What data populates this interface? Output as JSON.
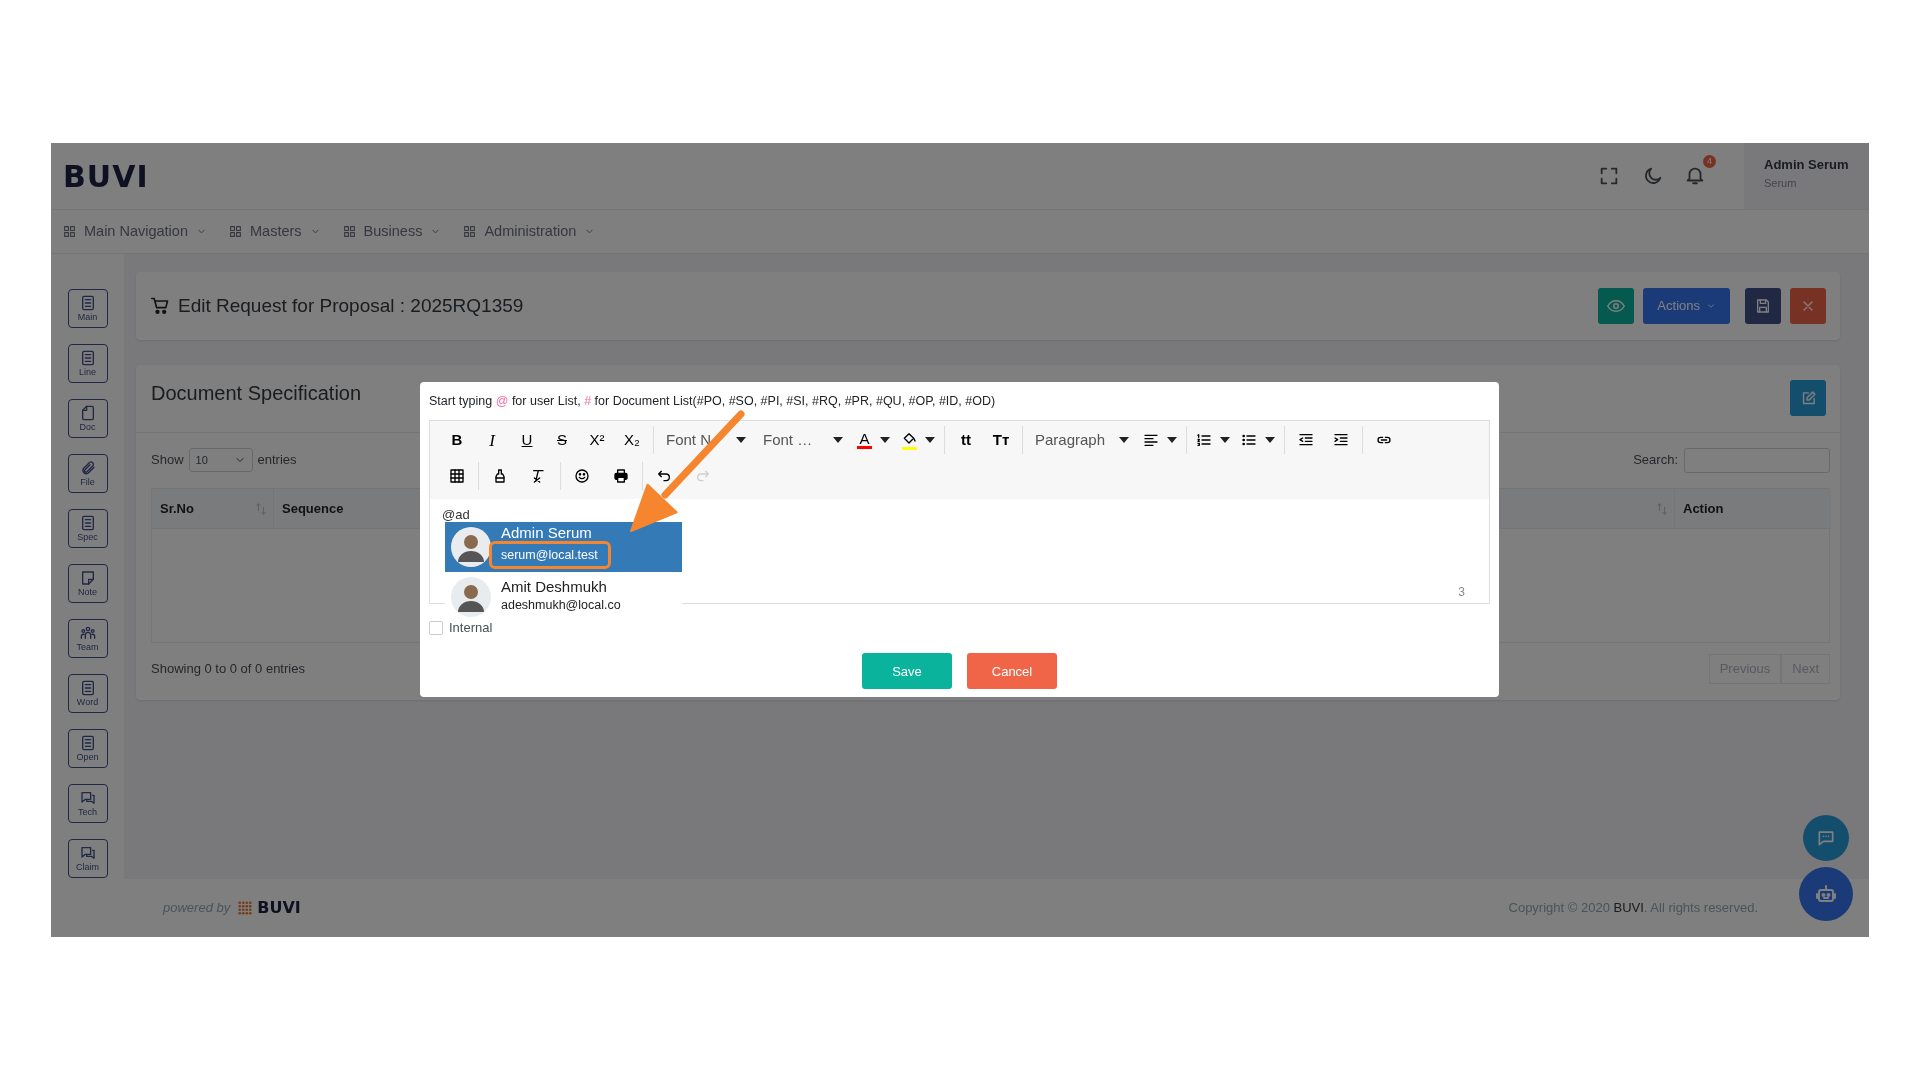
{
  "header": {
    "logo": "BUVI",
    "notification_count": "4",
    "user_name": "Admin Serum",
    "user_role": "Serum"
  },
  "nav": [
    {
      "label": "Main Navigation"
    },
    {
      "label": "Masters"
    },
    {
      "label": "Business"
    },
    {
      "label": "Administration"
    }
  ],
  "sidebar": [
    {
      "label": "Main",
      "kind": "list"
    },
    {
      "label": "Line",
      "kind": "list"
    },
    {
      "label": "Doc",
      "kind": "page"
    },
    {
      "label": "File",
      "kind": "clip"
    },
    {
      "label": "Spec",
      "kind": "list"
    },
    {
      "label": "Note",
      "kind": "note"
    },
    {
      "label": "Team",
      "kind": "team"
    },
    {
      "label": "Word",
      "kind": "list"
    },
    {
      "label": "Open",
      "kind": "list"
    },
    {
      "label": "Tech",
      "kind": "chat"
    },
    {
      "label": "Claim",
      "kind": "chat"
    }
  ],
  "page_header": {
    "title": "Edit Request for Proposal : 2025RQ1359",
    "actions_label": "Actions"
  },
  "spec_card": {
    "title": "Document Specification",
    "show_label": "Show",
    "page_size": "10",
    "entries_label": "entries",
    "search_label": "Search:",
    "columns": [
      {
        "label": "Sr.No",
        "sortable": true
      },
      {
        "label": "Sequence",
        "sortable": false
      },
      {
        "sortable": true
      },
      {
        "label": "Action",
        "sortable": false
      }
    ],
    "summary": "Showing 0 to 0 of 0 entries",
    "pager": [
      {
        "label": "Previous",
        "disabled": true
      },
      {
        "label": "Next",
        "disabled": true
      }
    ]
  },
  "modal": {
    "hint": [
      {
        "text": "Start typing ",
        "accent": false
      },
      {
        "text": "@",
        "accent": true
      },
      {
        "text": " for user List, ",
        "accent": false
      },
      {
        "text": "#",
        "accent": true
      },
      {
        "text": " for Document List(#PO, #SO, #PI, #SI, #RQ, #PR, #QU, #OP, #ID, #OD)",
        "accent": false
      }
    ],
    "toolbar": [
      [
        [
          {
            "kind": "bold",
            "text": "B"
          },
          {
            "kind": "italic",
            "text": "I"
          },
          {
            "kind": "underline",
            "text": "U"
          },
          {
            "kind": "strike",
            "text": "S"
          },
          {
            "kind": "sup",
            "text": "X²"
          },
          {
            "kind": "sub",
            "text": "X₂"
          }
        ],
        [
          {
            "kind": "select",
            "text": "Font N",
            "dropdown": true
          },
          {
            "kind": "select",
            "text": "Font …",
            "dropdown": true
          },
          {
            "kind": "forecolor",
            "text": "A",
            "color": "#ff0000",
            "dropdown": true
          },
          {
            "kind": "backcolor",
            "color": "#ffff00",
            "dropdown": true
          }
        ],
        [
          {
            "kind": "glyph",
            "text": "tt"
          },
          {
            "kind": "glyph",
            "text": "Tᴛ"
          }
        ],
        [
          {
            "kind": "select",
            "text": "Paragraph",
            "dropdown": true
          },
          {
            "kind": "align",
            "dropdown": true
          }
        ],
        [
          {
            "kind": "ol",
            "dropdown": true
          },
          {
            "kind": "ul",
            "dropdown": true
          }
        ],
        [
          {
            "kind": "outdent"
          },
          {
            "kind": "indent"
          }
        ],
        [
          {
            "kind": "link"
          }
        ]
      ],
      [
        [
          {
            "kind": "table"
          }
        ],
        [
          {
            "kind": "paint"
          },
          {
            "kind": "clear"
          }
        ],
        [
          {
            "kind": "emoji"
          },
          {
            "kind": "print"
          }
        ],
        [
          {
            "kind": "undo",
            "disabled": false
          },
          {
            "kind": "redo",
            "disabled": true
          }
        ]
      ]
    ],
    "content": "@ad",
    "word_count": "3",
    "mentions": [
      {
        "name": "Admin Serum",
        "email": "serum@local.test",
        "selected": true,
        "highlighted": true
      },
      {
        "name": "Amit Deshmukh",
        "email": "adeshmukh@local.co",
        "selected": false,
        "highlighted": false
      }
    ],
    "internal": {
      "label": "Internal",
      "checked": false
    },
    "buttons": [
      {
        "label": "Save",
        "kind": "save"
      },
      {
        "label": "Cancel",
        "kind": "cancel"
      }
    ]
  },
  "footer": {
    "powered_by": "powered by",
    "brand": "BUVI",
    "copyright": "Copyright © 2020 **BUVI**. All rights reserved."
  }
}
